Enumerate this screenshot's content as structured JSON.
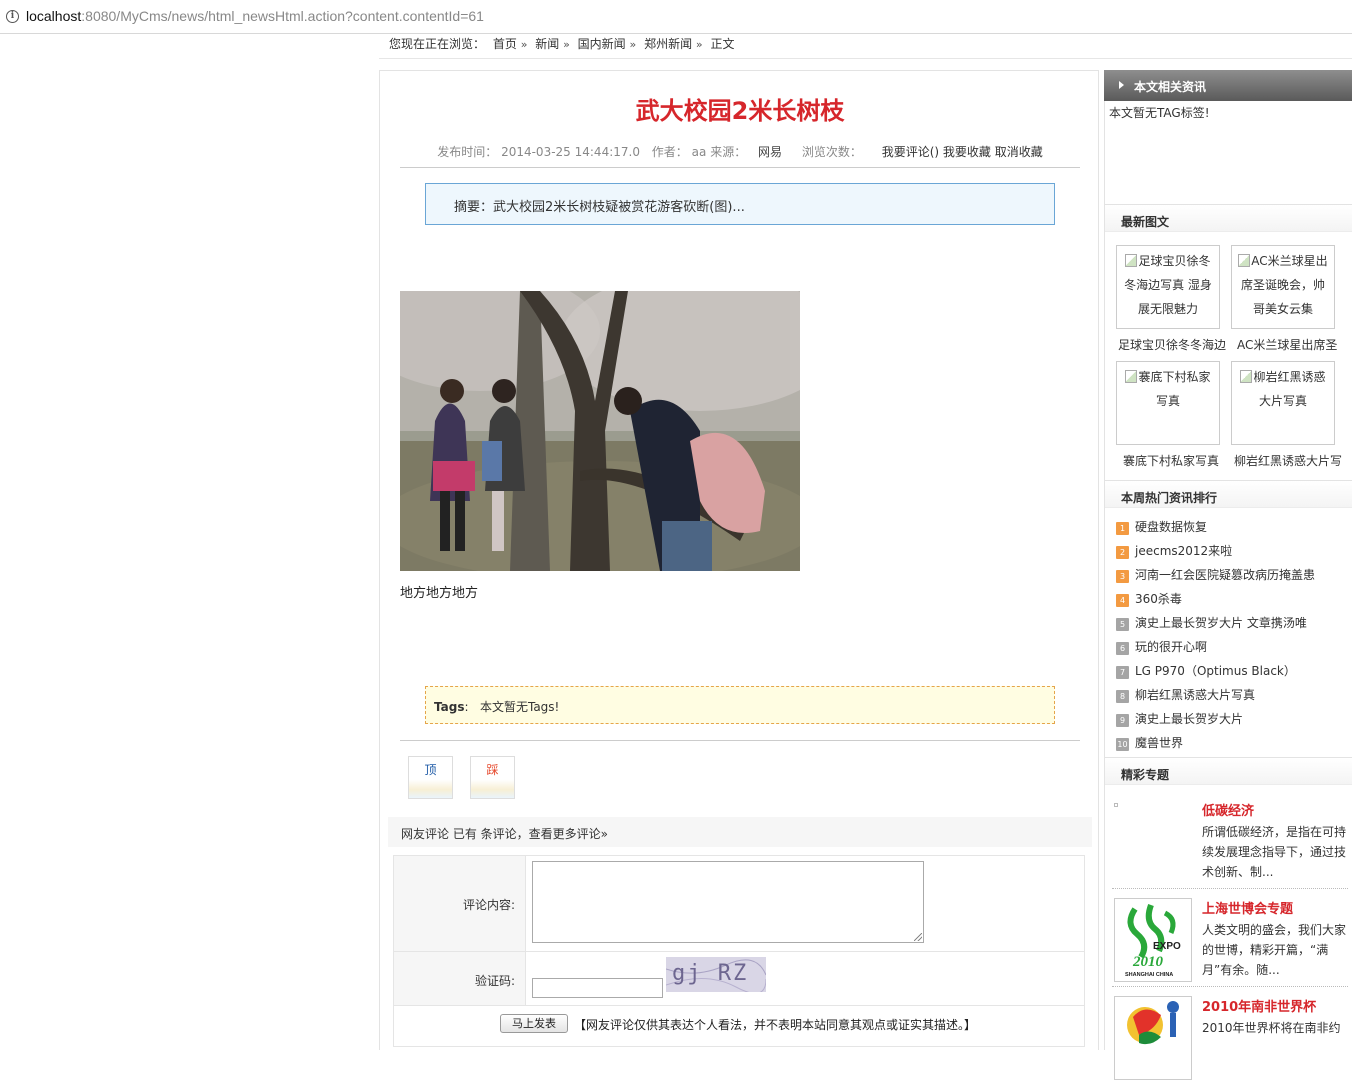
{
  "browser": {
    "url_host": "localhost",
    "url_rest": ":8080/MyCms/news/html_newsHtml.action?content.contentId=61"
  },
  "breadcrumb": {
    "prefix": "您现在正在浏览：",
    "items": [
      "首页",
      "新闻",
      "国内新闻",
      "郑州新闻",
      "正文"
    ]
  },
  "article": {
    "title": "武大校园2米长树枝",
    "meta": {
      "publish_label": "发布时间：",
      "publish_time": "2014-03-25 14:44:17.0",
      "author_label": "作者：",
      "author": "aa",
      "source_label": "来源：",
      "source": "网易",
      "views_label": "浏览次数：",
      "comment_link": "我要评论()",
      "fav_link": "我要收藏",
      "unfav_link": "取消收藏"
    },
    "summary_label": "摘要：",
    "summary": "武大校园2米长树枝疑被赏花游客砍断(图)...",
    "caption": "地方地方地方",
    "tags_label": "Tags",
    "tags_value": "本文暂无Tags!",
    "vote_up": "顶",
    "vote_down": "踩"
  },
  "comments": {
    "header": "网友评论 已有 条评论，查看更多评论»",
    "content_label": "评论内容:",
    "code_label": "验证码:",
    "captcha_text": "gj RZ",
    "submit_label": "马上发表",
    "notice": "【网友评论仅供其表达个人看法，并不表明本站同意其观点或证实其描述。】"
  },
  "sidebar": {
    "related_title": "本文相关资讯",
    "related_empty": "本文暂无TAG标签!",
    "latest_title": "最新图文",
    "latest": [
      {
        "alt": "足球宝贝徐冬冬海边写真 湿身展无限魅力",
        "caption": "足球宝贝徐冬冬海边"
      },
      {
        "alt": "AC米兰球星出席圣诞晚会，帅哥美女云集",
        "caption": "AC米兰球星出席圣"
      },
      {
        "alt": "褰底下村私家写真",
        "caption": "褰底下村私家写真"
      },
      {
        "alt": "柳岩红黑诱惑大片写真",
        "caption": "柳岩红黑诱惑大片写"
      }
    ],
    "hot_title": "本周热门资讯排行",
    "hot": [
      {
        "n": "1",
        "text": "硬盘数据恢复"
      },
      {
        "n": "2",
        "text": "jeecms2012来啦"
      },
      {
        "n": "3",
        "text": "河南一红会医院疑篡改病历掩盖患"
      },
      {
        "n": "4",
        "text": "360杀毒"
      },
      {
        "n": "5",
        "text": "演史上最长贺岁大片 文章携汤唯"
      },
      {
        "n": "6",
        "text": "玩的很开心啊"
      },
      {
        "n": "7",
        "text": "LG P970（Optimus Black）"
      },
      {
        "n": "8",
        "text": "柳岩红黑诱惑大片写真"
      },
      {
        "n": "9",
        "text": "演史上最长贺岁大片"
      },
      {
        "n": "10",
        "text": "魔兽世界"
      }
    ],
    "topics_title": "精彩专题",
    "topics": [
      {
        "title": "低碳经济",
        "desc": "所谓低碳经济，是指在可持续发展理念指导下，通过技术创新、制..."
      },
      {
        "title": "上海世博会专题",
        "desc": "人类文明的盛会，我们大家的世博，精彩开篇，“满月”有余。随..."
      },
      {
        "title": "2010年南非世界杯",
        "desc": "2010年世界杯将在南非约"
      }
    ],
    "expo_text": "EXPO",
    "expo_year": "2010",
    "expo_sub": "SHANGHAI CHINA"
  }
}
